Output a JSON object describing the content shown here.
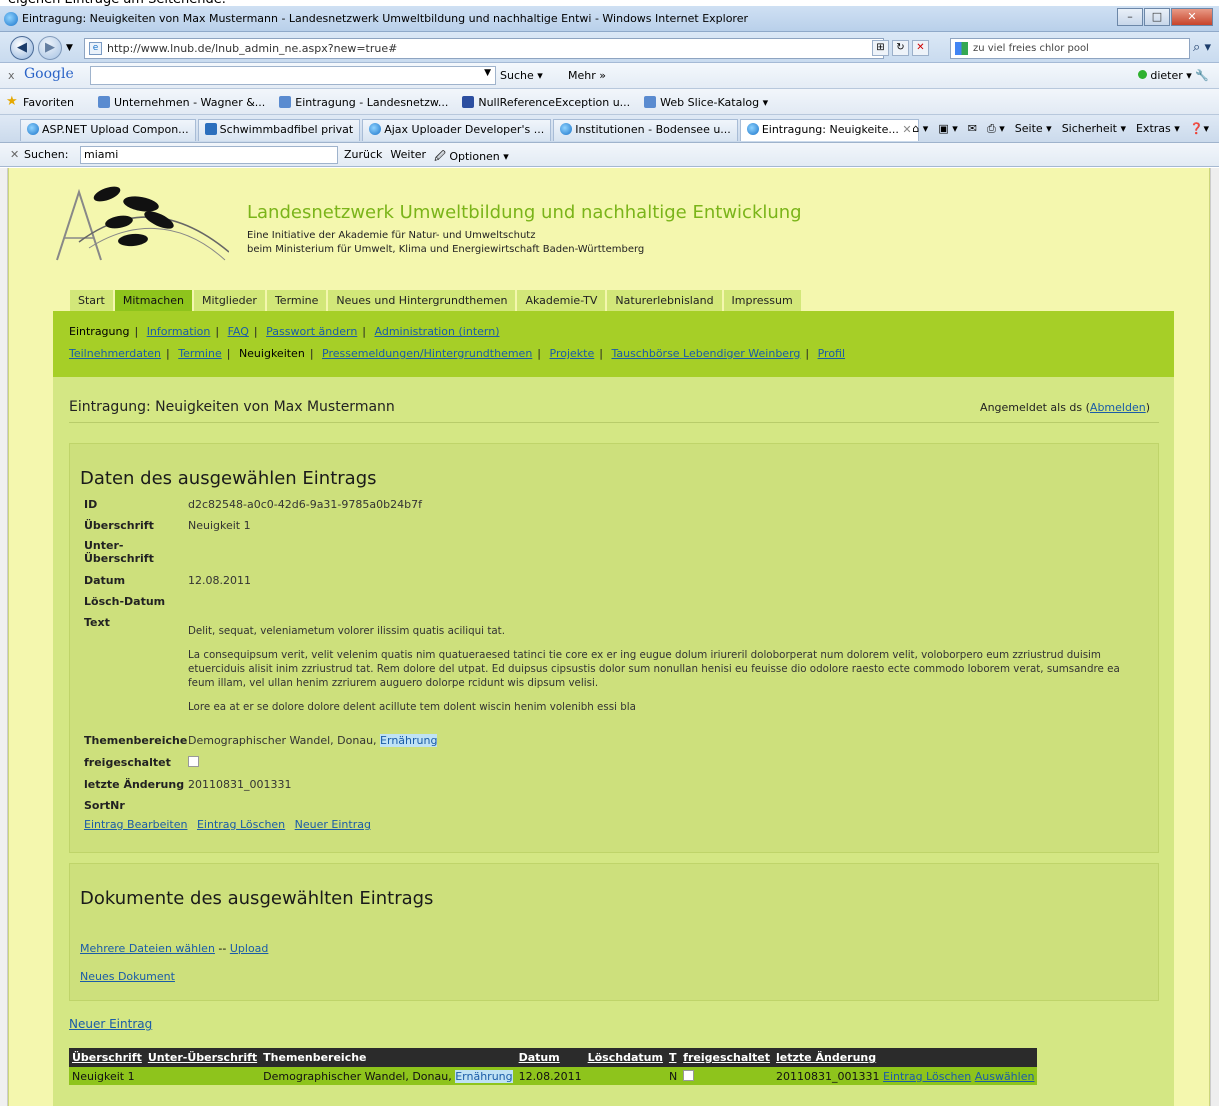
{
  "browser": {
    "title": "Eintragung: Neuigkeiten von Max Mustermann - Landesnetzwerk Umweltbildung und nachhaltige Entwi - Windows Internet Explorer",
    "url": "http://www.lnub.de/lnub_admin_ne.aspx?new=true#",
    "search_text": "zu viel freies chlor pool",
    "google": {
      "logo": "Google",
      "suche": "Suche ▾",
      "mehr": "Mehr »",
      "user": "dieter ▾"
    },
    "favorites": {
      "label": "Favoriten",
      "items": [
        "Unternehmen - Wagner &...",
        "Eintragung - Landesnetzw...",
        "NullReferenceException u...",
        "Web Slice-Katalog ▾"
      ]
    },
    "tabs": [
      "ASP.NET Upload Compon...",
      "Schwimmbadfibel privat",
      "Ajax Uploader Developer's ...",
      "Institutionen - Bodensee u...",
      "Eintragung: Neuigkeite..."
    ],
    "tab_tools": [
      "Seite ▾",
      "Sicherheit ▾",
      "Extras ▾"
    ],
    "find": {
      "label": "Suchen:",
      "value": "miami",
      "back": "Zurück",
      "next": "Weiter",
      "options": "Optionen ▾"
    }
  },
  "site": {
    "title": "Landesnetzwerk Umweltbildung und nachhaltige Entwicklung",
    "sub1": "Eine Initiative der Akademie für Natur- und Umweltschutz",
    "sub2": "beim Ministerium für Umwelt, Klima und Energiewirtschaft Baden-Württemberg",
    "mainnav": [
      "Start",
      "Mitmachen",
      "Mitglieder",
      "Termine",
      "Neues und Hintergrundthemen",
      "Akademie-TV",
      "Naturerlebnisland",
      "Impressum"
    ],
    "subnav_row1": [
      "Eintragung",
      "Information",
      "FAQ",
      "Passwort ändern",
      "Administration (intern)"
    ],
    "subnav_row2": [
      "Teilnehmerdaten",
      "Termine",
      "Neuigkeiten",
      "Pressemeldungen/Hintergrundthemen",
      "Projekte",
      "Tauschbörse Lebendiger Weinberg",
      "Profil"
    ]
  },
  "page": {
    "heading": "Eintragung: Neuigkeiten von Max Mustermann",
    "login_prefix": "Angemeldet als ds (",
    "logout": "Abmelden",
    "login_suffix": ")"
  },
  "detail": {
    "heading": "Daten des ausgewählen Eintrags",
    "labels": {
      "id": "ID",
      "title": "Überschrift",
      "subtitle": "Unter-Überschrift",
      "date": "Datum",
      "delete_date": "Lösch-Datum",
      "text": "Text",
      "topics": "Themenbereiche",
      "released": "freigeschaltet",
      "last_change": "letzte Änderung",
      "sort": "SortNr"
    },
    "id": "d2c82548-a0c0-42d6-9a31-9785a0b24b7f",
    "title": "Neuigkeit 1",
    "date": "12.08.2011",
    "text_p1": "Delit, sequat, veleniametum volorer ilissim quatis aciliqui tat.",
    "text_p2": "La consequipsum verit, velit velenim quatis nim quatueraesed tatinci tie core ex er ing eugue dolum iriureril doloborperat num dolorem velit, voloborpero eum zzriustrud duisim etuerciduis alisit inim zzriustrud tat. Rem dolore del utpat. Ed duipsus cipsustis dolor sum nonullan henisi eu feuisse dio odolore raesto ecte commodo loborem verat, sumsandre ea feum illam, vel ullan henim zzriurem auguero dolorpe rcidunt wis dipsum velisi.",
    "text_p3": "Lore ea at er se dolore dolore delent acillute tem dolent wiscin henim volenibh essi bla",
    "topics_plain": "Demographischer Wandel, Donau, ",
    "topics_hl": "Ernährung",
    "last_change": "20110831_001331",
    "actions": [
      "Eintrag Bearbeiten",
      "Eintrag Löschen",
      "Neuer Eintrag"
    ]
  },
  "docs": {
    "heading": "Dokumente des ausgewählten Eintrags",
    "multi": "Mehrere Dateien wählen",
    "sep": " -- ",
    "upload": "Upload",
    "new_doc": "Neues Dokument"
  },
  "list": {
    "new_entry": "Neuer Eintrag",
    "headers": [
      "Überschrift",
      "Unter-Überschrift",
      "Themenbereiche",
      "Datum",
      "Löschdatum",
      "T",
      "freigeschaltet",
      "letzte Änderung"
    ],
    "row": {
      "title": "Neuigkeit 1",
      "topics_plain": "Demographischer Wandel, Donau, ",
      "topics_hl": "Ernährung",
      "date": "12.08.2011",
      "t": "N",
      "last_change": "20110831_001331",
      "delete": "Eintrag Löschen",
      "select": "Auswählen"
    }
  }
}
